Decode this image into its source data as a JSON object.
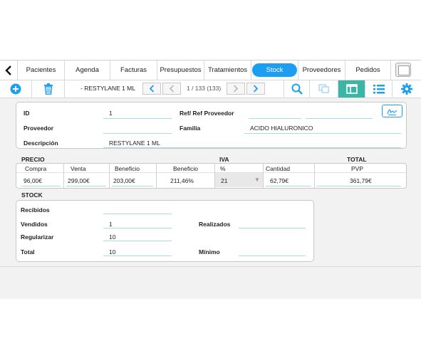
{
  "tabs": [
    "Pacientes",
    "Agenda",
    "Facturas",
    "Presupuestos",
    "Tratamientos",
    "Stock",
    "Proveedores",
    "Pedidos"
  ],
  "toolbar": {
    "record_name": "- RESTYLANE 1 ML",
    "counter": "1 / 133 (133)"
  },
  "form": {
    "id_label": "ID",
    "id_value": "1",
    "ref_label": "Ref/ Ref Proveedor",
    "proveedor_label": "Proveedor",
    "familia_label": "Familia",
    "familia_value": "ACIDO HIALURONICO",
    "descripcion_label": "Descripción",
    "descripcion_value": "RESTYLANE 1 ML"
  },
  "precio": {
    "title": "PRECIO",
    "iva_title": "IVA",
    "total_title": "TOTAL",
    "headers": [
      "Compra",
      "Venta",
      "Beneficio",
      "Beneficio",
      "%",
      "Cantidad",
      "PVP"
    ],
    "values": [
      "96,00€",
      "299,00€",
      "203,00€",
      "211,46%",
      "21",
      "62,79€",
      "361,79€"
    ]
  },
  "stock": {
    "title": "STOCK",
    "recibidos_label": "Recibidos",
    "vendidos_label": "Vendidos",
    "vendidos_value": "1",
    "realizados_label": "Realizados",
    "regularizar_label": "Regularizar",
    "regularizar_value": "10",
    "total_label": "Total",
    "total_value": "10",
    "minimo_label": "Mínimo"
  },
  "colors": {
    "accent": "#1e9ef0",
    "active_view": "#3bb5a5"
  },
  "icons": [
    "back-chevron-icon",
    "add-icon",
    "trash-icon",
    "prev-icon",
    "next-icon",
    "search-icon",
    "copy-icon",
    "form-view-icon",
    "list-view-icon",
    "gear-icon",
    "signature-icon"
  ]
}
